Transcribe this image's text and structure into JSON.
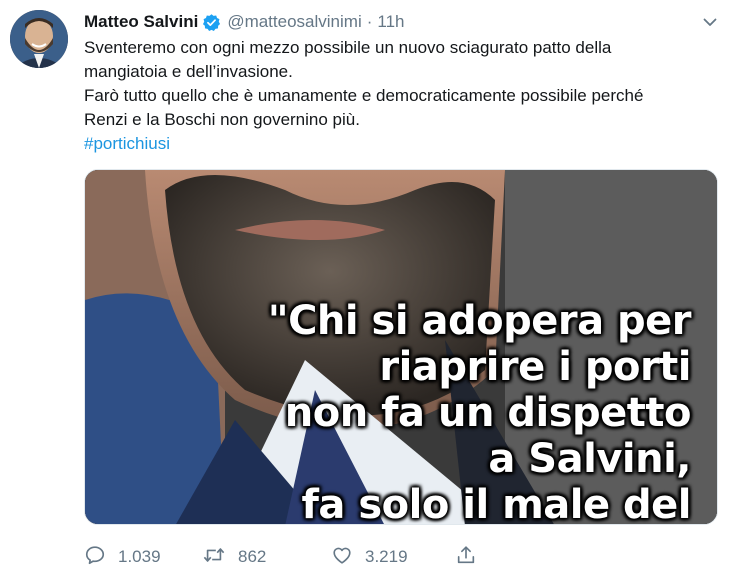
{
  "author": {
    "name": "Matteo Salvini",
    "handle": "@matteosalvinimi",
    "separator": "·",
    "time": "11h",
    "verified_color": "#1da1f2"
  },
  "tweet": {
    "lines": [
      "Sventeremo con ogni mezzo possibile un nuovo sciagurato patto della",
      "mangiatoia e dell’invasione.",
      "Farò tutto quello che è umanamente e democraticamente possibile perché",
      "Renzi e la Boschi non governino più."
    ],
    "hashtag": "#portichiusi"
  },
  "media": {
    "quote_lines": [
      "\"Chi si adopera per",
      "riaprire i porti",
      "non fa un dispetto",
      "a Salvini,",
      "fa solo il male del"
    ]
  },
  "actions": {
    "reply_count": "1.039",
    "retweet_count": "862",
    "like_count": "3.219"
  },
  "icons": {
    "reply": "reply-icon",
    "retweet": "retweet-icon",
    "like": "heart-icon",
    "share": "share-icon",
    "more": "chevron-down-icon",
    "verified": "verified-badge-icon"
  },
  "colors": {
    "text": "#14171a",
    "muted": "#657786",
    "link": "#1b95e0"
  }
}
